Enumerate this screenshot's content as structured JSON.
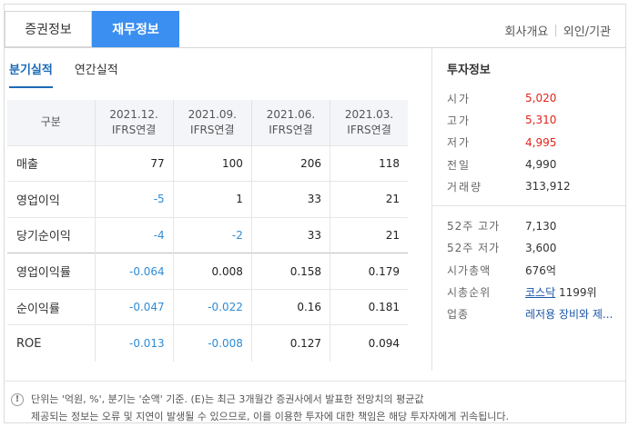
{
  "top_tabs": [
    "증권정보",
    "재무정보"
  ],
  "top_links": [
    "회사개요",
    "외인/기관"
  ],
  "sub_tabs": [
    "분기실적",
    "연간실적"
  ],
  "table": {
    "header": {
      "label": "구분",
      "periods": [
        {
          "date": "2021.12.",
          "basis": "IFRS연결"
        },
        {
          "date": "2021.09.",
          "basis": "IFRS연결"
        },
        {
          "date": "2021.06.",
          "basis": "IFRS연결"
        },
        {
          "date": "2021.03.",
          "basis": "IFRS연결"
        }
      ]
    },
    "rows": [
      {
        "label": "매출",
        "values": [
          "77",
          "100",
          "206",
          "118"
        ]
      },
      {
        "label": "영업이익",
        "values": [
          "-5",
          "1",
          "33",
          "21"
        ]
      },
      {
        "label": "당기순이익",
        "values": [
          "-4",
          "-2",
          "33",
          "21"
        ]
      },
      {
        "label": "영업이익률",
        "values": [
          "-0.064",
          "0.008",
          "0.158",
          "0.179"
        ]
      },
      {
        "label": "순이익률",
        "values": [
          "-0.047",
          "-0.022",
          "0.16",
          "0.181"
        ]
      },
      {
        "label": "ROE",
        "values": [
          "-0.013",
          "-0.008",
          "0.127",
          "0.094"
        ]
      }
    ]
  },
  "invest": {
    "title": "투자정보",
    "prices": [
      {
        "key": "시가",
        "value": "5,020"
      },
      {
        "key": "고가",
        "value": "5,310"
      },
      {
        "key": "저가",
        "value": "4,995"
      },
      {
        "key": "전일",
        "value": "4,990"
      },
      {
        "key": "거래량",
        "value": "313,912"
      }
    ],
    "stats": [
      {
        "key": "52주 고가",
        "value": "7,130"
      },
      {
        "key": "52주 저가",
        "value": "3,600"
      },
      {
        "key": "시가총액",
        "value": "676억"
      }
    ],
    "rank": {
      "key": "시총순위",
      "market": "코스닥",
      "value": "1199위"
    },
    "industry": {
      "key": "업종",
      "value": "레저용 장비와 제..."
    }
  },
  "colors": {
    "accent": "#3b8ff0",
    "negative": "#2f8cd6",
    "up": "#e2231a",
    "link": "#1a55a5"
  },
  "note": {
    "icon": "!",
    "line1": "단위는 '억원, %', 분기는 '순액' 기준. (E)는 최근 3개월간 증권사에서 발표한 전망치의 평균값",
    "line2": "제공되는 정보는 오류 및 지연이 발생될 수 있으므로, 이를 이용한 투자에 대한 책임은 해당 투자자에게 귀속됩니다."
  }
}
